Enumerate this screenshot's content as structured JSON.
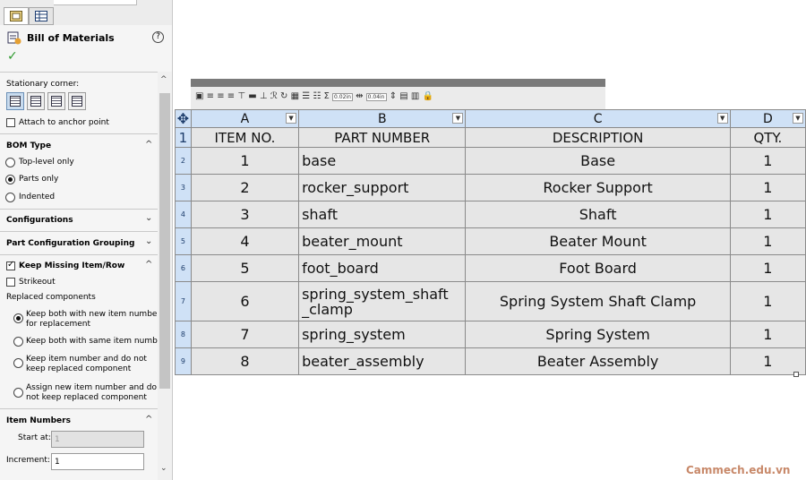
{
  "panel": {
    "title": "Bill of Materials",
    "help_icon": "?",
    "ok_icon": "✓",
    "stationary_corner_label": "Stationary corner:",
    "attach_anchor_label": "Attach to anchor point",
    "bom_type": {
      "header": "BOM Type",
      "options": [
        "Top-level only",
        "Parts only",
        "Indented"
      ],
      "selected": "Parts only"
    },
    "configurations_header": "Configurations",
    "part_config_grouping_header": "Part Configuration Grouping",
    "keep_missing": {
      "header": "Keep Missing Item/Row",
      "checked": true,
      "strikeout_label": "Strikeout",
      "replaced_label": "Replaced components",
      "options": [
        [
          "Keep both with new item number",
          "for replacement"
        ],
        [
          "Keep both with same item number"
        ],
        [
          "Keep item number and do not",
          "keep replaced component"
        ],
        [
          "Assign new item number and do",
          "not keep replaced component"
        ]
      ]
    },
    "item_numbers": {
      "header": "Item Numbers",
      "start_at_label": "Start at:",
      "start_at_value": "1",
      "increment_label": "Increment:",
      "increment_value": "1"
    }
  },
  "toolbar": {
    "font_size_1": "0.02in",
    "font_size_2": "0.04in"
  },
  "bom": {
    "columns": [
      "A",
      "B",
      "C",
      "D"
    ],
    "title_row": {
      "row": "1",
      "item": "ITEM NO.",
      "part": "PART NUMBER",
      "desc": "DESCRIPTION",
      "qty": "QTY."
    },
    "rows": [
      {
        "row": "2",
        "item": "1",
        "part": "base",
        "desc": "Base",
        "qty": "1"
      },
      {
        "row": "3",
        "item": "2",
        "part": "rocker_support",
        "desc": "Rocker Support",
        "qty": "1"
      },
      {
        "row": "4",
        "item": "3",
        "part": "shaft",
        "desc": "Shaft",
        "qty": "1"
      },
      {
        "row": "5",
        "item": "4",
        "part": "beater_mount",
        "desc": "Beater Mount",
        "qty": "1"
      },
      {
        "row": "6",
        "item": "5",
        "part": "foot_board",
        "desc": "Foot Board",
        "qty": "1"
      },
      {
        "row": "7",
        "item": "6",
        "part": "spring_system_shaft\n_clamp",
        "desc": "Spring System Shaft Clamp",
        "qty": "1"
      },
      {
        "row": "8",
        "item": "7",
        "part": "spring_system",
        "desc": "Spring System",
        "qty": "1"
      },
      {
        "row": "9",
        "item": "8",
        "part": "beater_assembly",
        "desc": "Beater Assembly",
        "qty": "1"
      }
    ]
  },
  "watermark": "Cammech.edu.vn"
}
